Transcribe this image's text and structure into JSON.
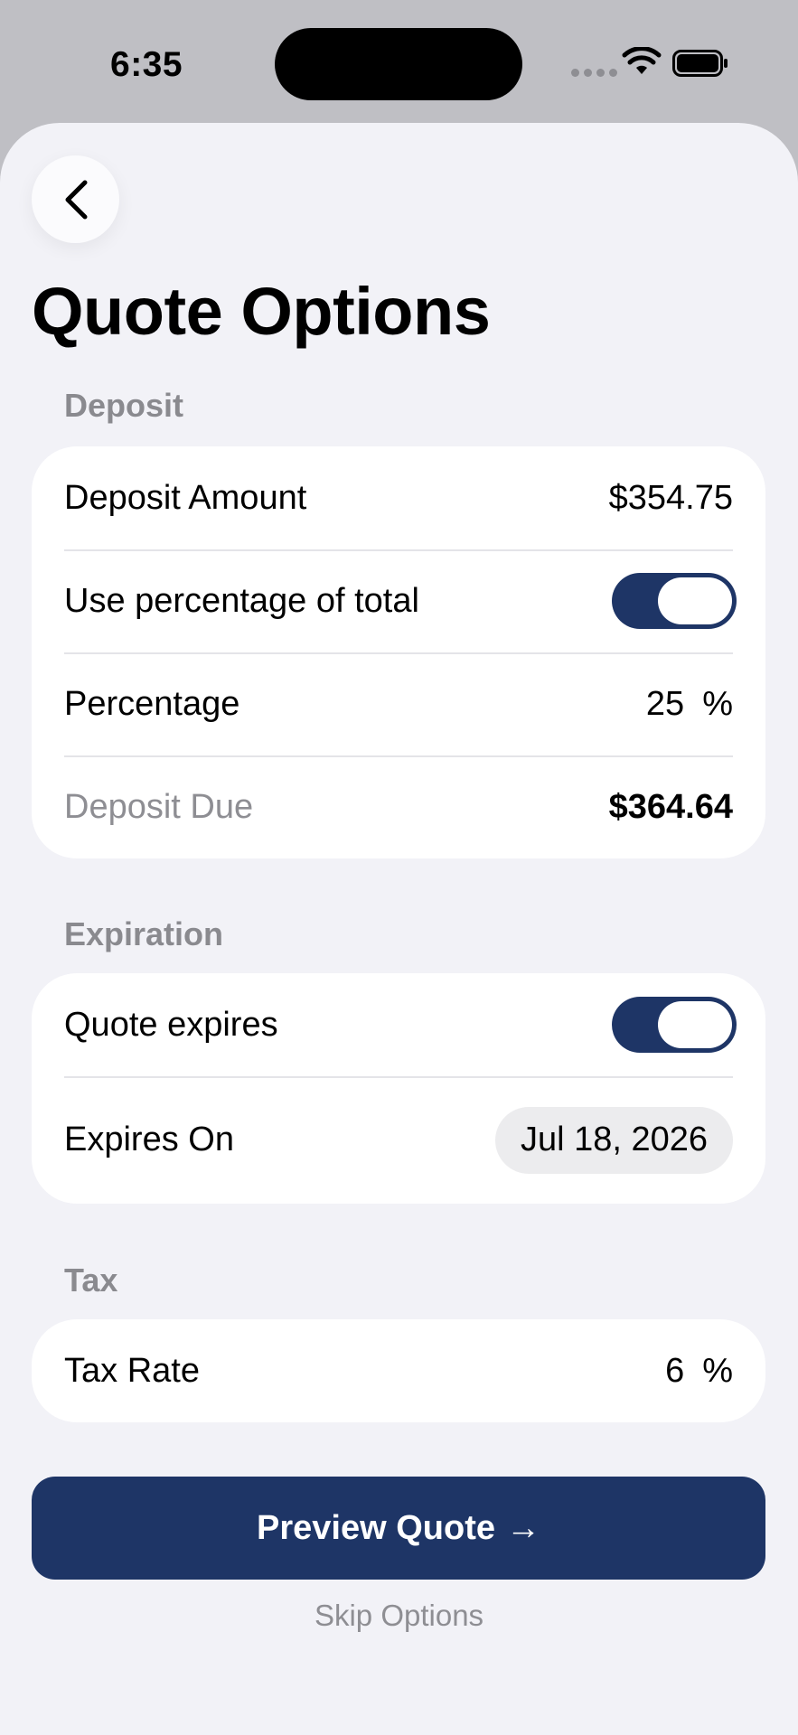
{
  "status_bar": {
    "time": "6:35"
  },
  "header": {
    "title": "Quote Options"
  },
  "deposit": {
    "section_title": "Deposit",
    "amount_label": "Deposit Amount",
    "amount_value": "$354.75",
    "use_percentage_label": "Use percentage of total",
    "use_percentage_on": true,
    "percentage_label": "Percentage",
    "percentage_value": "25",
    "percentage_unit": "%",
    "due_label": "Deposit Due",
    "due_value": "$364.64"
  },
  "expiration": {
    "section_title": "Expiration",
    "expires_label": "Quote expires",
    "expires_on": true,
    "expires_on_label": "Expires On",
    "expires_on_value": "Jul 18, 2026"
  },
  "tax": {
    "section_title": "Tax",
    "rate_label": "Tax Rate",
    "rate_value": "6",
    "rate_unit": "%"
  },
  "actions": {
    "preview_label": "Preview Quote",
    "preview_arrow": "→",
    "skip_label": "Skip Options"
  },
  "colors": {
    "accent": "#1e3566",
    "background": "#f2f2f7",
    "muted": "#8e8e93"
  },
  "icons": [
    "back-chevron-icon",
    "signal-dots-icon",
    "wifi-icon",
    "battery-icon",
    "arrow-right-icon"
  ]
}
